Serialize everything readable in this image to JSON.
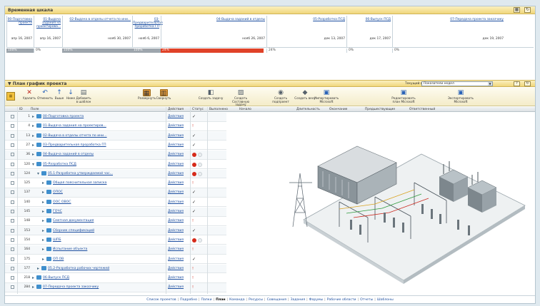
{
  "timeline": {
    "title": "Временная шкала",
    "columns": [
      {
        "label": "00-Подготовка проекта",
        "date": "апр 16, 2007"
      },
      {
        "label": "01-Выдача задания на проектирова...",
        "date": "апр 16, 2007"
      },
      {
        "label": "02-Выдача в отделы отчета по ини...",
        "date": "нояб 30, 2007"
      },
      {
        "label": "03-Предварительная проработка ГП",
        "date": "нояб 6, 2007"
      },
      {
        "label": "04-Выдача заданий в отделы",
        "date": "нояб 26, 2007"
      },
      {
        "label": "05-Разработка ПСД",
        "date": "дек 13, 2007"
      },
      {
        "label": "06-Выпуск ПСД",
        "date": "дек 17, 2007"
      },
      {
        "label": "07-Передача проекта заказчику",
        "date": "дек 19, 2007"
      }
    ],
    "progress": [
      {
        "label": "100%",
        "value": 100,
        "style": "gray"
      },
      {
        "label": "0%",
        "value": 0,
        "style": "empty"
      },
      {
        "label": "100%",
        "value": 100,
        "style": "gray"
      },
      {
        "label": "100%",
        "value": 100,
        "style": "gray"
      },
      {
        "label": "24%",
        "value": 24,
        "style": "red"
      },
      {
        "label": "24%",
        "value": 24,
        "style": "empty"
      },
      {
        "label": "0%",
        "value": 0,
        "style": "empty"
      },
      {
        "label": "0%",
        "value": 0,
        "style": "empty"
      }
    ]
  },
  "plan": {
    "title": "План график проекта",
    "view_label": "Текущий вид",
    "view_value": "Показатели недел"
  },
  "toolbar": [
    {
      "label": "Удалить",
      "icon": "delete-icon"
    },
    {
      "label": "Отменить",
      "icon": "undo-icon"
    },
    {
      "label": "Выше",
      "icon": "move-up-icon"
    },
    {
      "label": "Ниже",
      "icon": "move-down-icon"
    },
    {
      "label": "Добавить в шаблон",
      "icon": "add-template-icon"
    },
    {
      "label": "Развернуть",
      "icon": "expand-icon"
    },
    {
      "label": "Свернуть",
      "icon": "collapse-icon"
    },
    {
      "label": "Создать задачу",
      "icon": "create-task-icon"
    },
    {
      "label": "Создать Составную задачу",
      "icon": "create-composite-task-icon"
    },
    {
      "label": "Создать подпроект",
      "icon": "create-subproject-icon"
    },
    {
      "label": "Создать веху",
      "icon": "create-milestone-icon"
    },
    {
      "label": "Импортировать Microsoft",
      "icon": "import-icon"
    },
    {
      "label": "Редактировать план Microsoft",
      "icon": "edit-plan-icon"
    },
    {
      "label": "Экспортировать Microsoft",
      "icon": "export-icon"
    }
  ],
  "grid": {
    "headers": {
      "id": "ID",
      "name": "Поле",
      "actions": "Действия",
      "status": "Статус",
      "done": "Выполнено",
      "start": "Начало",
      "duration": "Длительность",
      "finish": "Окончание",
      "predecessors": "Предшествующие",
      "responsible": "Ответственный"
    },
    "rows": [
      {
        "id": "1",
        "level": 0,
        "expanded": false,
        "name": "00-Подготовка проекта",
        "action": "Действия",
        "status": "check"
      },
      {
        "id": "4",
        "level": 0,
        "expanded": false,
        "name": "01-Выдача задания на проектиров...",
        "action": "Действия",
        "status": "warn"
      },
      {
        "id": "13",
        "level": 0,
        "expanded": false,
        "name": "02-Выдача в отделы отчета по ини...",
        "action": "Действия",
        "status": "check"
      },
      {
        "id": "27",
        "level": 0,
        "expanded": false,
        "name": "03-Предварительная проработка ГП",
        "action": "Действия",
        "status": "check"
      },
      {
        "id": "36",
        "level": 0,
        "expanded": false,
        "name": "04-Выдача заданий в отделы",
        "action": "Действия",
        "status": "dot"
      },
      {
        "id": "120",
        "level": 0,
        "expanded": true,
        "name": "05-Разработка ПСД",
        "action": "Действия",
        "status": "dot"
      },
      {
        "id": "124",
        "level": 1,
        "expanded": true,
        "name": "05.1-Разработка утверждаемой час...",
        "action": "Действия",
        "status": "dot"
      },
      {
        "id": "125",
        "level": 2,
        "expanded": false,
        "name": "Общая пояснительная записка",
        "action": "Действия",
        "status": "warn"
      },
      {
        "id": "137",
        "level": 2,
        "expanded": false,
        "name": "ОПОС",
        "action": "Действия",
        "status": "check"
      },
      {
        "id": "140",
        "level": 2,
        "expanded": false,
        "name": "ООС ОВОС",
        "action": "Действия",
        "status": "check"
      },
      {
        "id": "145",
        "level": 2,
        "expanded": false,
        "name": "ГОЧС",
        "action": "Действия",
        "status": "check"
      },
      {
        "id": "148",
        "level": 2,
        "expanded": false,
        "name": "Сметная документация",
        "action": "Действия",
        "status": "warn"
      },
      {
        "id": "153",
        "level": 2,
        "expanded": false,
        "name": "Сборник спецификаций",
        "action": "Действия",
        "status": "check"
      },
      {
        "id": "154",
        "level": 2,
        "expanded": false,
        "name": "ШПБ",
        "action": "Действия",
        "status": "dot"
      },
      {
        "id": "164",
        "level": 2,
        "expanded": false,
        "name": "Испытание объекта",
        "action": "Действия",
        "status": "warn"
      },
      {
        "id": "175",
        "level": 2,
        "expanded": false,
        "name": "ОП ОВ",
        "action": "Действия",
        "status": "check"
      },
      {
        "id": "177",
        "level": 1,
        "expanded": false,
        "name": "05.2-Разработка рабочих чертежей",
        "action": "Действия",
        "status": "warn"
      },
      {
        "id": "218",
        "level": 0,
        "expanded": false,
        "name": "06-Выпуск ПСД",
        "action": "Действия",
        "status": "warn"
      },
      {
        "id": "284",
        "level": 0,
        "expanded": false,
        "name": "07-Передача проекта заказчику",
        "action": "Действия",
        "status": "warn"
      }
    ]
  },
  "footer": {
    "links": [
      "Список проектов",
      "Подробно",
      "Папки",
      "План",
      "Команда",
      "Ресурсы",
      "Совещания",
      "Задания",
      "Форумы",
      "Рабочие области",
      "Отчеты",
      "Шаблоны"
    ],
    "active": "План"
  },
  "colors": {
    "accent_header": "#f0d67b",
    "progress_gray": "#9ea6ad",
    "progress_red": "#e04228",
    "link": "#1d4fa0",
    "status_red": "#d62a1a"
  }
}
